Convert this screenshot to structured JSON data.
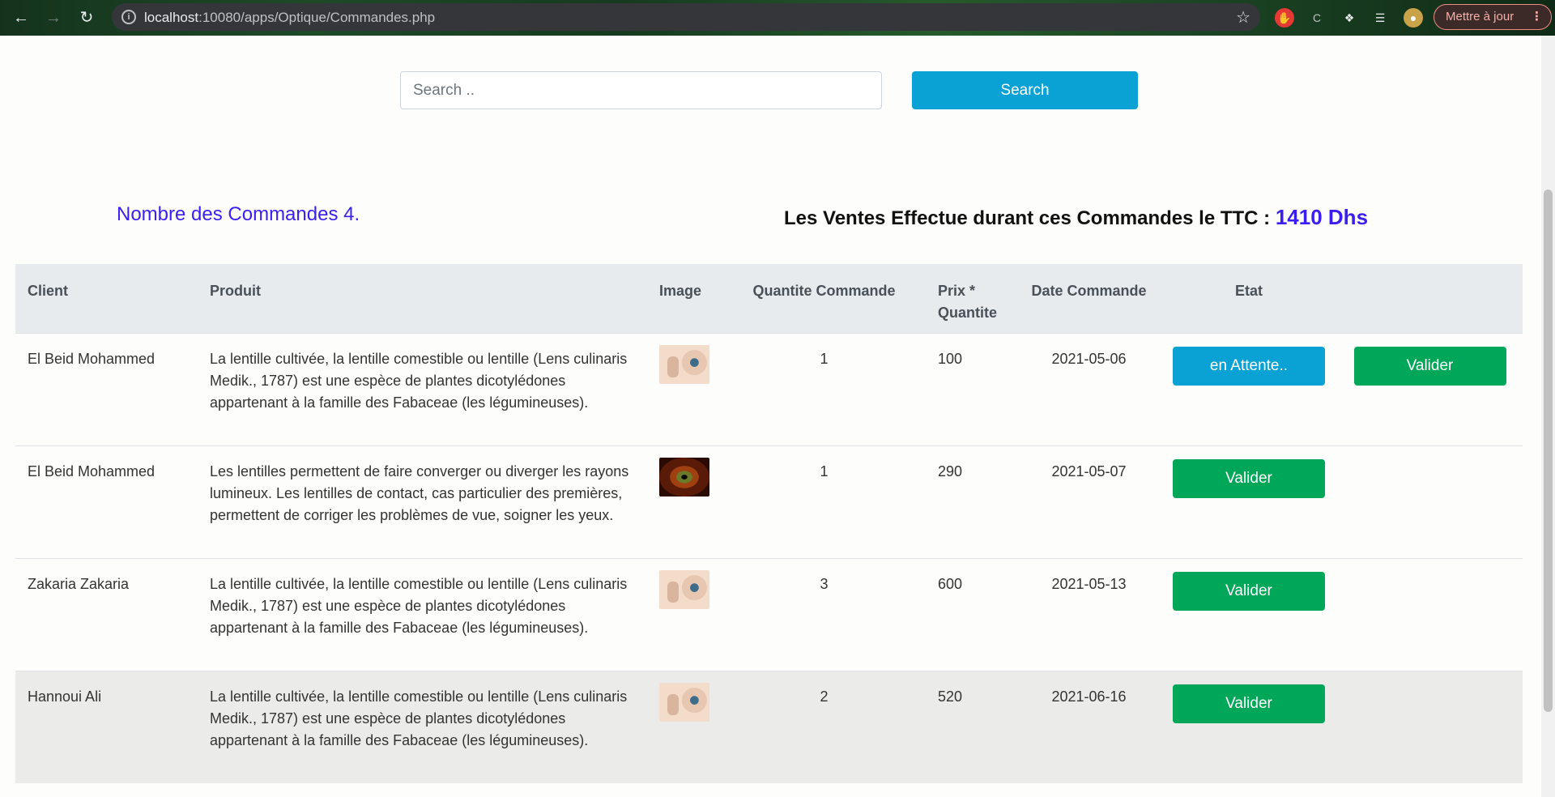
{
  "browser": {
    "url_host": "localhost",
    "url_path": ":10080/apps/Optique/Commandes.php",
    "update_label": "Mettre à jour"
  },
  "search": {
    "placeholder": "Search ..",
    "button_label": "Search"
  },
  "summary": {
    "count_text": "Nombre des Commandes 4.",
    "ventes_text": "Les Ventes Effectue durant ces Commandes le TTC : ",
    "ventes_amount": "1410 Dhs"
  },
  "table": {
    "headers": {
      "client": "Client",
      "produit": "Produit",
      "image": "Image",
      "quantite": "Quantite Commande",
      "prix": "Prix * Quantite",
      "date": "Date Commande",
      "etat": "Etat"
    },
    "rows": [
      {
        "client": "El Beid Mohammed",
        "produit": "La lentille cultivée, la lentille comestible ou lentille (Lens culinaris Medik., 1787) est une espèce de plantes dicotylédones appartenant à la famille des Fabaceae (les légumineuses).",
        "image": "lens-image",
        "quantite": "1",
        "prix": "100",
        "date": "2021-05-06",
        "wait_label": "en Attente..",
        "valider_label": "Valider"
      },
      {
        "client": "El Beid Mohammed",
        "produit": "Les lentilles permettent de faire converger ou diverger les rayons lumineux. Les lentilles de contact, cas particulier des premières, permettent de corriger les problèmes de vue, soigner les yeux.",
        "image": "eye-image",
        "quantite": "1",
        "prix": "290",
        "date": "2021-05-07",
        "valider_label": "Valider"
      },
      {
        "client": "Zakaria Zakaria",
        "produit": "La lentille cultivée, la lentille comestible ou lentille (Lens culinaris Medik., 1787) est une espèce de plantes dicotylédones appartenant à la famille des Fabaceae (les légumineuses).",
        "image": "lens-image",
        "quantite": "3",
        "prix": "600",
        "date": "2021-05-13",
        "valider_label": "Valider"
      },
      {
        "client": "Hannoui Ali",
        "produit": "La lentille cultivée, la lentille comestible ou lentille (Lens culinaris Medik., 1787) est une espèce de plantes dicotylédones appartenant à la famille des Fabaceae (les légumineuses).",
        "image": "lens-image",
        "quantite": "2",
        "prix": "520",
        "date": "2021-06-16",
        "valider_label": "Valider"
      }
    ]
  },
  "colors": {
    "accent_blue": "#0aa1d4",
    "valider_green": "#00a758",
    "summary_purple": "#3a1ef2"
  }
}
